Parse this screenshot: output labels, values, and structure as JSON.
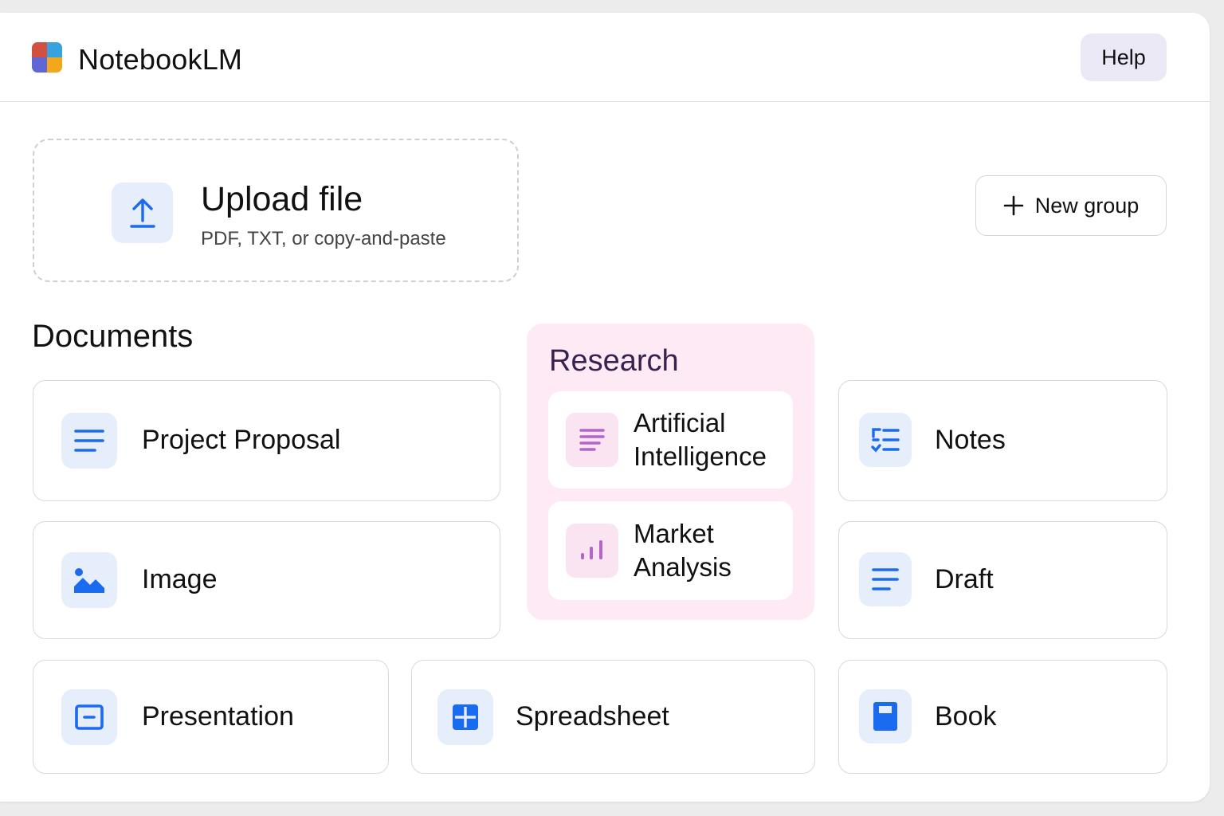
{
  "app": {
    "title": "NotebookLM",
    "logo_colors": [
      "#d2503f",
      "#36a3e0",
      "#5f67d6",
      "#f2a81d"
    ]
  },
  "header": {
    "help_label": "Help"
  },
  "upload": {
    "title": "Upload file",
    "subtitle": "PDF, TXT, or copy-and-paste",
    "icon": "upload-icon"
  },
  "new_group": {
    "label": "New group",
    "icon": "plus-icon"
  },
  "documents": {
    "title": "Documents",
    "items": [
      {
        "label": "Project Proposal",
        "icon": "text-lines-icon"
      },
      {
        "label": "Image",
        "icon": "image-icon"
      },
      {
        "label": "Presentation",
        "icon": "presentation-icon"
      },
      {
        "label": "Spreadsheet",
        "icon": "grid-icon"
      },
      {
        "label": "Notes",
        "icon": "checklist-icon"
      },
      {
        "label": "Draft",
        "icon": "text-lines-icon"
      },
      {
        "label": "Book",
        "icon": "book-icon"
      }
    ]
  },
  "research": {
    "title": "Research",
    "items": [
      {
        "label_line1": "Artificial",
        "label_line2": "Intelligence",
        "icon": "text-lines-icon"
      },
      {
        "label_line1": "Market",
        "label_line2": "Analysis",
        "icon": "bar-chart-icon"
      }
    ]
  },
  "colors": {
    "accent_blue": "#1a6bf0",
    "icon_bg_blue": "#e6eefc",
    "research_bg": "#fdeaf4",
    "research_icon": "#b266c8",
    "help_bg": "#ece9f6"
  }
}
